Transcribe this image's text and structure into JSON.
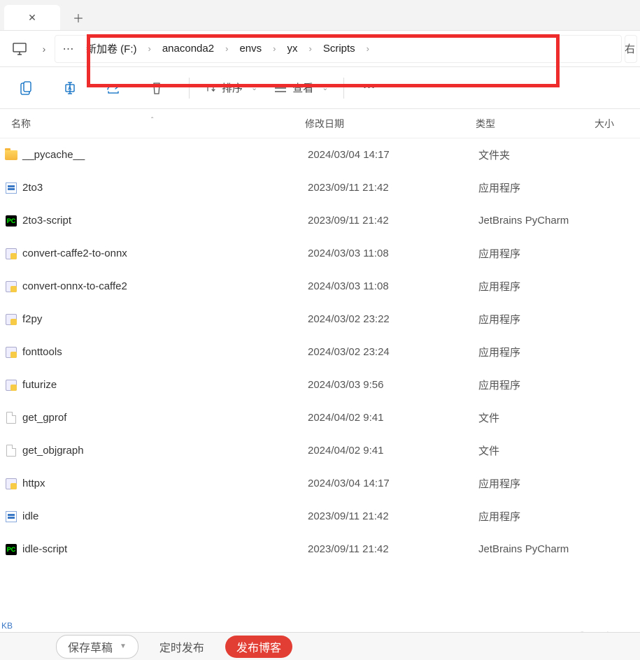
{
  "breadcrumbs": [
    "新加卷 (F:)",
    "anaconda2",
    "envs",
    "yx",
    "Scripts"
  ],
  "toolbar": {
    "sort_label": "排序",
    "view_label": "查看"
  },
  "columns": {
    "name": "名称",
    "date": "修改日期",
    "type": "类型",
    "size": "大小"
  },
  "files": [
    {
      "icon": "folder",
      "name": "__pycache__",
      "date": "2024/03/04 14:17",
      "type": "文件夹"
    },
    {
      "icon": "exe",
      "name": "2to3",
      "date": "2023/09/11 21:42",
      "type": "应用程序"
    },
    {
      "icon": "pc",
      "name": "2to3-script",
      "date": "2023/09/11 21:42",
      "type": "JetBrains PyCharm"
    },
    {
      "icon": "py",
      "name": "convert-caffe2-to-onnx",
      "date": "2024/03/03 11:08",
      "type": "应用程序"
    },
    {
      "icon": "py",
      "name": "convert-onnx-to-caffe2",
      "date": "2024/03/03 11:08",
      "type": "应用程序"
    },
    {
      "icon": "py",
      "name": "f2py",
      "date": "2024/03/02 23:22",
      "type": "应用程序"
    },
    {
      "icon": "py",
      "name": "fonttools",
      "date": "2024/03/02 23:24",
      "type": "应用程序"
    },
    {
      "icon": "py",
      "name": "futurize",
      "date": "2024/03/03 9:56",
      "type": "应用程序"
    },
    {
      "icon": "file",
      "name": "get_gprof",
      "date": "2024/04/02 9:41",
      "type": "文件"
    },
    {
      "icon": "file",
      "name": "get_objgraph",
      "date": "2024/04/02 9:41",
      "type": "文件"
    },
    {
      "icon": "py",
      "name": "httpx",
      "date": "2024/03/04 14:17",
      "type": "应用程序"
    },
    {
      "icon": "exe",
      "name": "idle",
      "date": "2023/09/11 21:42",
      "type": "应用程序"
    },
    {
      "icon": "pc",
      "name": "idle-script",
      "date": "2023/09/11 21:42",
      "type": "JetBrains PyCharm"
    }
  ],
  "status": "KB",
  "watermark": "CSDN @conch0329",
  "bottom": {
    "save_draft": "保存草稿",
    "scheduled": "定时发布",
    "publish": "发布博客"
  },
  "rightcut_label": "右"
}
